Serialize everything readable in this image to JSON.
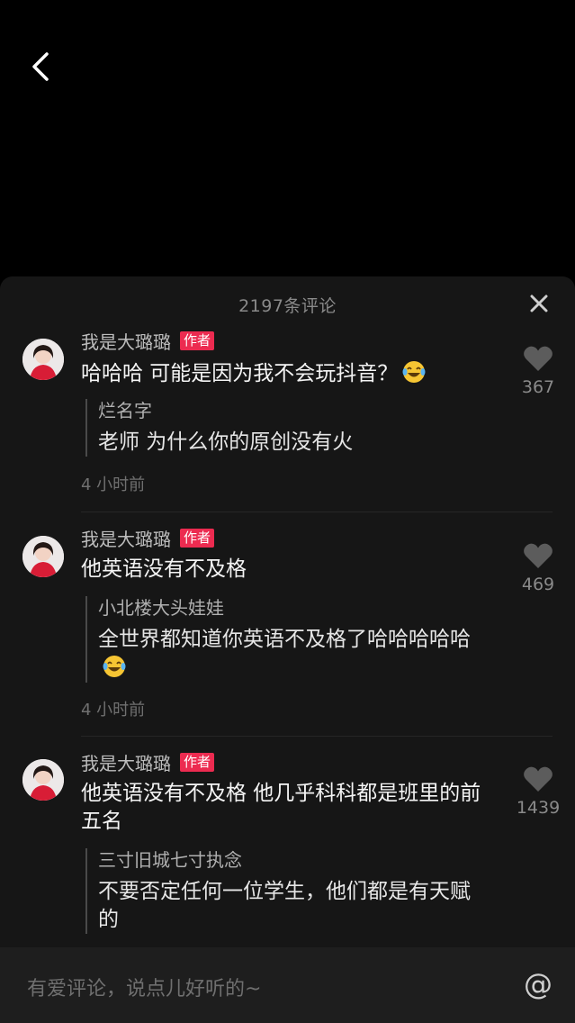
{
  "sheet": {
    "comment_count": "2197条评论"
  },
  "comments": [
    {
      "author": "我是大璐璐",
      "tag": "作者",
      "text": "哈哈哈 可能是因为我不会玩抖音？",
      "emoji": "laughing-tears-emoji",
      "reply_name": "烂名字",
      "reply_text": "老师 为什么你的原创没有火",
      "time": "4 小时前",
      "likes": "367"
    },
    {
      "author": "我是大璐璐",
      "tag": "作者",
      "text": "他英语没有不及格",
      "reply_name": "小北楼大头娃娃",
      "reply_text": "全世界都知道你英语不及格了哈哈哈哈哈",
      "reply_emoji": "laughing-tears-emoji",
      "time": "4 小时前",
      "likes": "469"
    },
    {
      "author": "我是大璐璐",
      "tag": "作者",
      "text": "他英语没有不及格 他几乎科科都是班里的前五名",
      "reply_name": "三寸旧城七寸执念",
      "reply_text": "不要否定任何一位学生，他们都是有天赋的",
      "likes": "1439"
    }
  ],
  "input": {
    "placeholder": "有爱评论，说点儿好听的~",
    "at_symbol": "@"
  },
  "colors": {
    "author_tag": "#ec2b50",
    "sheet_bg": "#161616",
    "page_bg": "#000000"
  }
}
